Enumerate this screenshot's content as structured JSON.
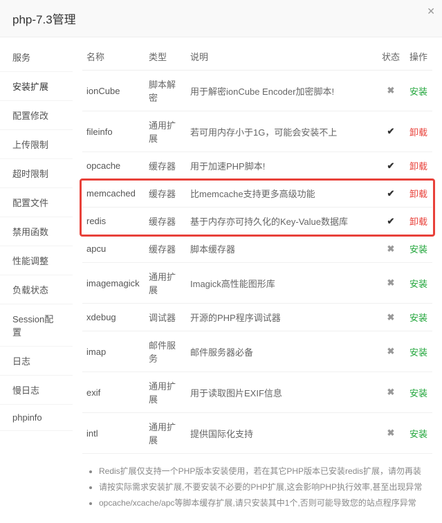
{
  "header": {
    "title": "php-7.3管理"
  },
  "sidebar": {
    "items": [
      {
        "label": "服务"
      },
      {
        "label": "安装扩展",
        "active": true
      },
      {
        "label": "配置修改"
      },
      {
        "label": "上传限制"
      },
      {
        "label": "超时限制"
      },
      {
        "label": "配置文件"
      },
      {
        "label": "禁用函数"
      },
      {
        "label": "性能调整"
      },
      {
        "label": "负载状态"
      },
      {
        "label": "Session配置"
      },
      {
        "label": "日志"
      },
      {
        "label": "慢日志"
      },
      {
        "label": "phpinfo"
      }
    ]
  },
  "columns": {
    "name": "名称",
    "type": "类型",
    "desc": "说明",
    "status": "状态",
    "action": "操作"
  },
  "actions": {
    "install": "安装",
    "uninstall": "卸载"
  },
  "rows": [
    {
      "name": "ionCube",
      "type": "脚本解密",
      "desc": "用于解密ionCube Encoder加密脚本!",
      "installed": false
    },
    {
      "name": "fileinfo",
      "type": "通用扩展",
      "desc": "若可用内存小于1G，可能会安装不上",
      "installed": true
    },
    {
      "name": "opcache",
      "type": "缓存器",
      "desc": "用于加速PHP脚本!",
      "installed": true
    },
    {
      "name": "memcached",
      "type": "缓存器",
      "desc": "比memcache支持更多高级功能",
      "installed": true,
      "hl": "start"
    },
    {
      "name": "redis",
      "type": "缓存器",
      "desc": "基于内存亦可持久化的Key-Value数据库",
      "installed": true,
      "hl": "end"
    },
    {
      "name": "apcu",
      "type": "缓存器",
      "desc": "脚本缓存器",
      "installed": false
    },
    {
      "name": "imagemagick",
      "type": "通用扩展",
      "desc": "Imagick高性能图形库",
      "installed": false
    },
    {
      "name": "xdebug",
      "type": "调试器",
      "desc": "开源的PHP程序调试器",
      "installed": false
    },
    {
      "name": "imap",
      "type": "邮件服务",
      "desc": "邮件服务器必备",
      "installed": false
    },
    {
      "name": "exif",
      "type": "通用扩展",
      "desc": "用于读取图片EXIF信息",
      "installed": false
    },
    {
      "name": "intl",
      "type": "通用扩展",
      "desc": "提供国际化支持",
      "installed": false
    }
  ],
  "notes": [
    "Redis扩展仅支持一个PHP版本安装使用，若在其它PHP版本已安装redis扩展，请勿再装",
    "请按实际需求安装扩展,不要安装不必要的PHP扩展,这会影响PHP执行效率,甚至出现异常",
    "opcache/xcache/apc等脚本缓存扩展,请只安装其中1个,否则可能导致您的站点程序异常"
  ]
}
